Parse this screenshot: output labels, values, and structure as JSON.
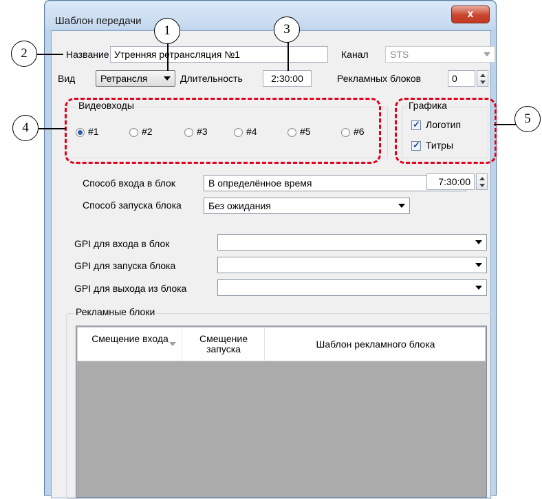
{
  "window": {
    "title": "Шаблон передачи",
    "close_glyph": "x"
  },
  "form": {
    "name_label": "Название",
    "name_value": "Утренняя ретрансляция №1",
    "channel_label": "Канал",
    "channel_value": "STS",
    "type_label": "Вид",
    "type_value": "Ретрансля",
    "duration_label": "Длительность",
    "duration_value": "2:30:00",
    "ad_blocks_label": "Рекламных блоков",
    "ad_blocks_value": "0"
  },
  "video_inputs": {
    "title": "Видеовходы",
    "options": [
      "#1",
      "#2",
      "#3",
      "#4",
      "#5",
      "#6"
    ],
    "selected": "#1"
  },
  "graphics": {
    "title": "Графика",
    "items": [
      {
        "label": "Логотип",
        "checked": true
      },
      {
        "label": "Титры",
        "checked": true
      }
    ]
  },
  "block_settings": {
    "entry_method_label": "Способ входа в блок",
    "entry_method_value": "В определённое время",
    "entry_time_value": "7:30:00",
    "start_method_label": "Способ запуска блока",
    "start_method_value": "Без ожидания"
  },
  "gpi": {
    "entry_label": "GPI для входа в блок",
    "entry_value": "",
    "start_label": "GPI для запуска блока",
    "start_value": "",
    "exit_label": "GPI для выхода из блока",
    "exit_value": ""
  },
  "ad_blocks": {
    "title": "Рекламные блоки",
    "columns": [
      "Смещение входа",
      "Смещение запуска",
      "Шаблон рекламного блока"
    ]
  },
  "callouts": [
    "1",
    "2",
    "3",
    "4",
    "5"
  ],
  "colors": {
    "highlight": "#e0001b",
    "window_frame": "#bcd3ec",
    "close_button": "#c9452e"
  }
}
